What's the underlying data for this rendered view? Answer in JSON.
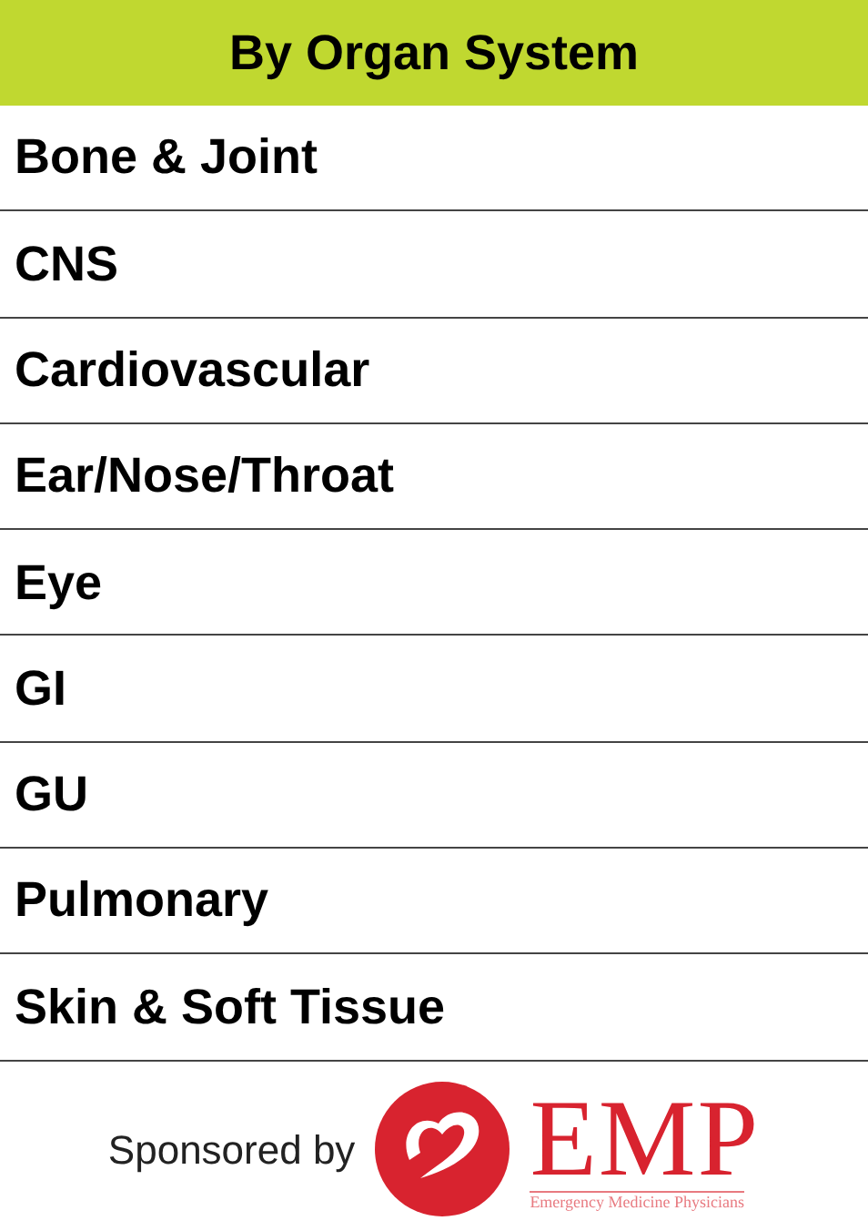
{
  "header": {
    "title": "By Organ System"
  },
  "items": [
    {
      "label": "Bone & Joint"
    },
    {
      "label": "CNS"
    },
    {
      "label": "Cardiovascular"
    },
    {
      "label": "Ear/Nose/Throat"
    },
    {
      "label": "Eye"
    },
    {
      "label": "GI"
    },
    {
      "label": "GU"
    },
    {
      "label": "Pulmonary"
    },
    {
      "label": "Skin & Soft Tissue"
    }
  ],
  "footer": {
    "sponsor_text": "Sponsored by",
    "logo_name": "EMP",
    "logo_tagline": "Emergency Medicine Physicians"
  }
}
